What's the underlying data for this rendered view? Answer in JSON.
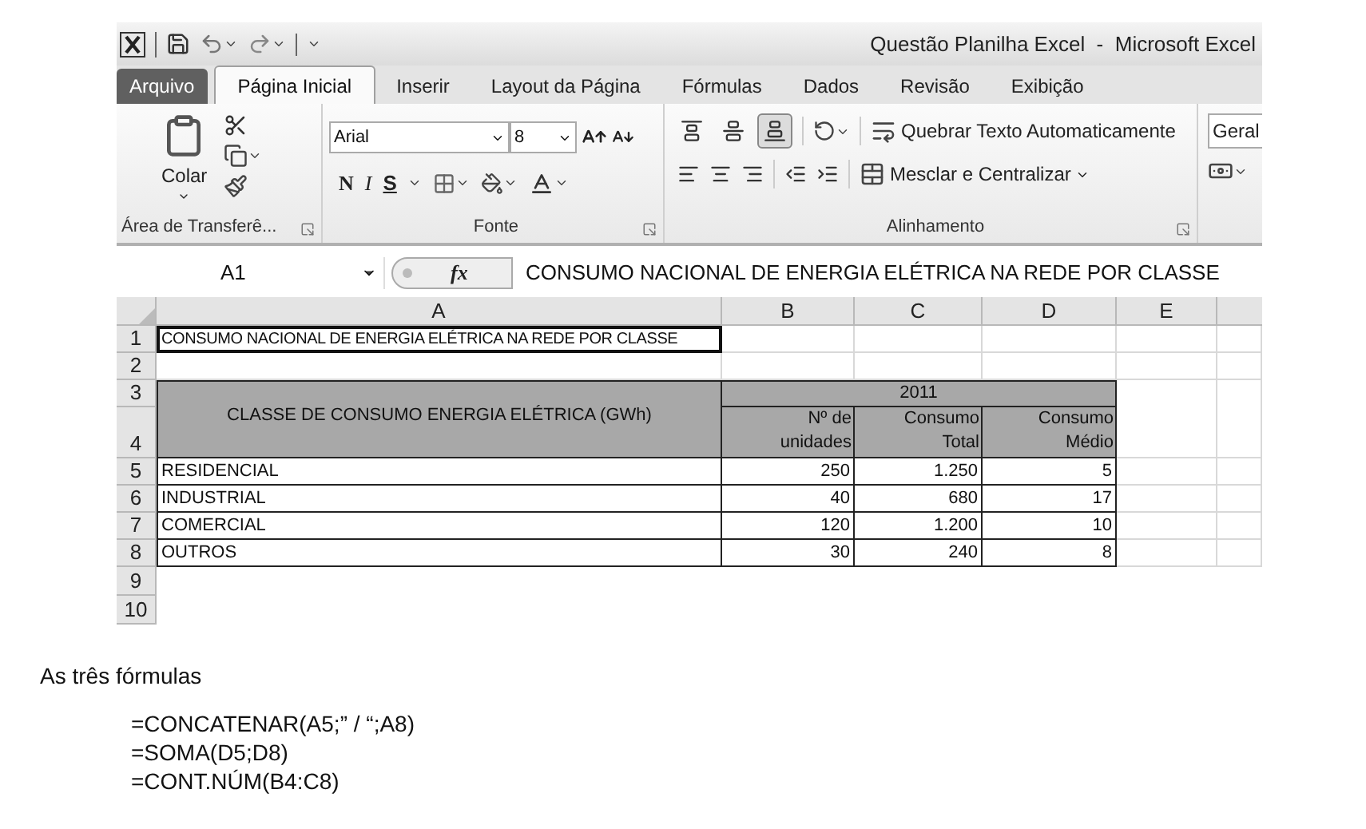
{
  "window": {
    "title": "Questão Planilha Excel  -  Microsoft Excel"
  },
  "ribbon_tabs": [
    {
      "label": "Arquivo",
      "kind": "file",
      "selected": false
    },
    {
      "label": "Página Inicial",
      "kind": "tab",
      "selected": true
    },
    {
      "label": "Inserir",
      "kind": "tab",
      "selected": false
    },
    {
      "label": "Layout da Página",
      "kind": "tab",
      "selected": false
    },
    {
      "label": "Fórmulas",
      "kind": "tab",
      "selected": false
    },
    {
      "label": "Dados",
      "kind": "tab",
      "selected": false
    },
    {
      "label": "Revisão",
      "kind": "tab",
      "selected": false
    },
    {
      "label": "Exibição",
      "kind": "tab",
      "selected": false
    }
  ],
  "clipboard": {
    "paste": "Colar",
    "group": "Área de Transferê..."
  },
  "font": {
    "name": "Arial",
    "size": "8",
    "bold": "N",
    "italic": "I",
    "underline": "S",
    "group": "Fonte"
  },
  "alignment": {
    "vertical": [
      {
        "selected": false
      },
      {
        "selected": false
      },
      {
        "selected": true
      }
    ],
    "wrap": "Quebrar Texto Automaticamente",
    "merge": "Mesclar e Centralizar",
    "group": "Alinhamento"
  },
  "number": {
    "format": "Geral"
  },
  "formula_bar": {
    "name_box": "A1",
    "fx": "fx",
    "value": "CONSUMO NACIONAL DE ENERGIA ELÉTRICA NA REDE POR CLASSE"
  },
  "sheet": {
    "columns": [
      "A",
      "B",
      "C",
      "D",
      "E"
    ],
    "row_numbers": [
      "1",
      "2",
      "3",
      "4",
      "5",
      "6",
      "7",
      "8",
      "9",
      "10"
    ],
    "title": "CONSUMO NACIONAL DE ENERGIA ELÉTRICA NA REDE POR CLASSE",
    "header": "CLASSE DE CONSUMO ENERGIA ELÉTRICA (GWh)",
    "year": "2011",
    "subheaders": [
      "Nº de\nunidades",
      "Consumo\nTotal",
      "Consumo\nMédio"
    ],
    "rows": [
      [
        "RESIDENCIAL",
        "250",
        "1.250",
        "5"
      ],
      [
        "INDUSTRIAL",
        "40",
        "680",
        "17"
      ],
      [
        "COMERCIAL",
        "120",
        "1.200",
        "10"
      ],
      [
        "OUTROS",
        "30",
        "240",
        "8"
      ]
    ]
  },
  "below": {
    "heading": "As três fórmulas",
    "formulas": [
      "=CONCATENAR(A5;” / “;A8)",
      "=SOMA(D5;D8)",
      "=CONT.NÚM(B4:C8)"
    ]
  }
}
